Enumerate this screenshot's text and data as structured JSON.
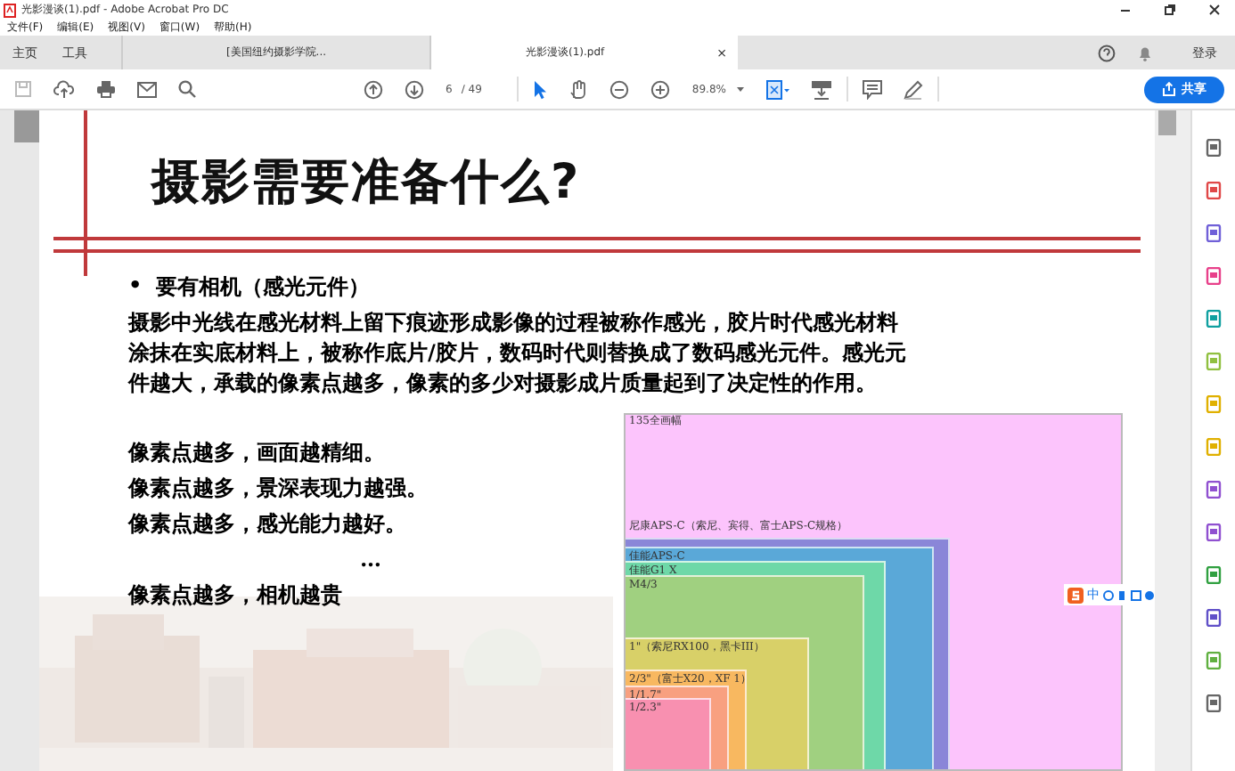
{
  "window": {
    "title": "光影漫谈(1).pdf - Adobe Acrobat Pro DC"
  },
  "menu": [
    "文件(F)",
    "编辑(E)",
    "视图(V)",
    "窗口(W)",
    "帮助(H)"
  ],
  "tabs": [
    {
      "label": "主页",
      "kind": "nav",
      "selected": false
    },
    {
      "label": "工具",
      "kind": "nav",
      "selected": false
    },
    {
      "label": "[美国纽约摄影学院...",
      "kind": "doc",
      "selected": false
    },
    {
      "label": "光影漫谈(1).pdf",
      "kind": "doc",
      "selected": true,
      "close": "×"
    }
  ],
  "account": {
    "sign_in": "登录"
  },
  "toolbar": {
    "page": "6",
    "pages": "/ 49",
    "zoom": "89.8%",
    "share": "共享"
  },
  "slide": {
    "title": "摄影需要准备什么?",
    "bullet_mark": "•",
    "bullet": "要有相机（感光元件）",
    "paragraph": "摄影中光线在感光材料上留下痕迹形成影像的过程被称作感光，胶片时代感光材料涂抹在实底材料上，被称作底片/胶片，数码时代则替换成了数码感光元件。感光元件越大，承载的像素点越多，像素的多少对摄影成片质量起到了决定性的作用。",
    "lines": [
      "像素点越多，画面越精细。",
      "像素点越多，景深表现力越强。",
      "像素点越多，感光能力越好。",
      "…",
      "像素点越多，相机越贵"
    ],
    "sensors": [
      {
        "label": "135全画幅"
      },
      {
        "label": "尼康APS-C（索尼、宾得、富士APS-C规格）"
      },
      {
        "label": "佳能APS-C"
      },
      {
        "label": "佳能G1 X"
      },
      {
        "label": "M4/3"
      },
      {
        "label": "1\"（索尼RX100，黑卡III）"
      },
      {
        "label": "2/3\"（富士X20，XF 1）"
      },
      {
        "label": "1/1.7\""
      },
      {
        "label": "1/2.3\""
      }
    ]
  },
  "ime": {
    "mode": "中"
  }
}
